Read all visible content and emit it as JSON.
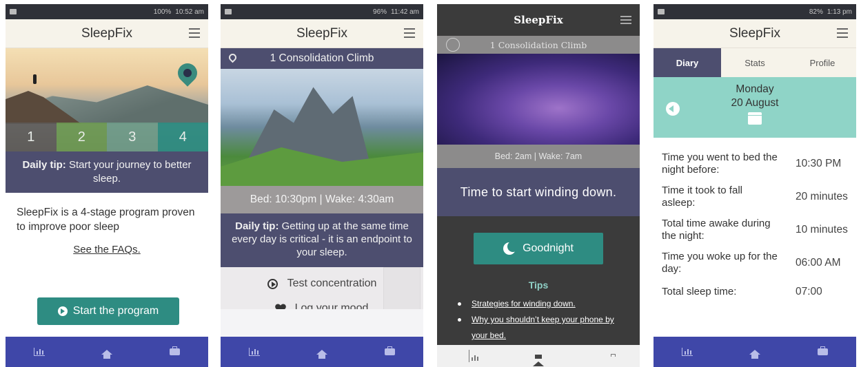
{
  "app_name": "SleepFix",
  "phone1": {
    "status_time": "10:52 am",
    "status_battery": "100%",
    "stages": [
      "1",
      "2",
      "3",
      "4"
    ],
    "tip_label": "Daily tip:",
    "tip_text": " Start your journey to better sleep.",
    "intro": "SleepFix is a 4-stage program proven to improve poor sleep",
    "faq_link": "See the FAQs.",
    "start_button": "Start the program",
    "stage_colors": [
      "#5d5a59",
      "#6d9a52",
      "#6f9c8a",
      "#2e8c82"
    ]
  },
  "phone2": {
    "status_time": "11:42 am",
    "status_battery": "96%",
    "stage_title": "1 Consolidation Climb",
    "schedule": "Bed: 10:30pm | Wake: 4:30am",
    "tip_label": "Daily tip:",
    "tip_text": " Getting up at the same time every day is critical - it is an endpoint to your sleep.",
    "action_test": "Test concentration",
    "action_mood": "Log your mood"
  },
  "phone3": {
    "stage_title": "1 Consolidation Climb",
    "schedule": "Bed: 2am  |  Wake: 7am",
    "winding": "Time to start winding down.",
    "goodnight": "Goodnight",
    "tips_title": "Tips",
    "tips": [
      "Strategies for winding down.",
      "Why you shouldn’t keep your phone by your bed."
    ]
  },
  "phone4": {
    "status_time": "1:13 pm",
    "status_battery": "82%",
    "tabs": [
      "Diary",
      "Stats",
      "Profile"
    ],
    "day": "Monday",
    "date": "20 August",
    "rows": [
      {
        "q": "Time you went to bed the night before:",
        "a": "10:30 PM"
      },
      {
        "q": "Time it took to fall asleep:",
        "a": "20 minutes"
      },
      {
        "q": "Total time awake during the night:",
        "a": "10 minutes"
      },
      {
        "q": "Time you woke up for the day:",
        "a": "06:00 AM"
      },
      {
        "q": "Total sleep time:",
        "a": "07:00"
      }
    ]
  },
  "colors": {
    "primary_purple": "#4d4e6f",
    "teal": "#2e8c82",
    "nav_blue": "#3f47a8",
    "mint": "#8fd4c7"
  }
}
